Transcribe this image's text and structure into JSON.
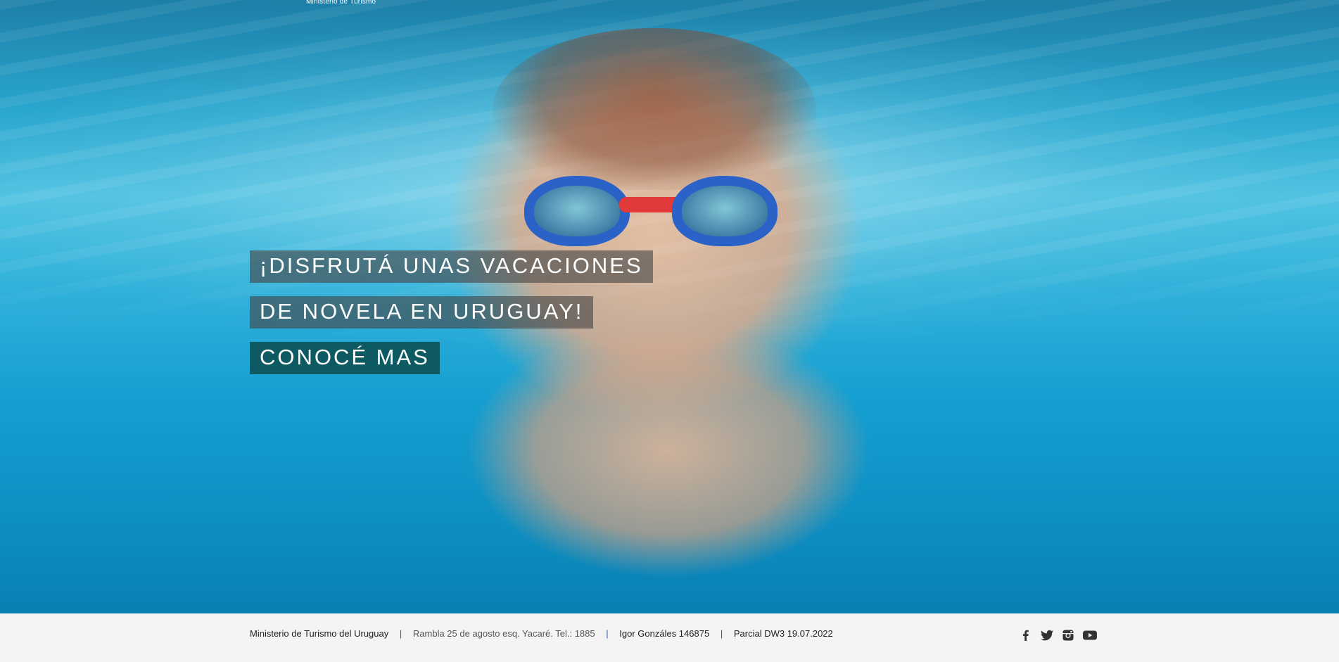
{
  "header": {
    "site_tag": "Ministerio de Turismo"
  },
  "hero": {
    "headline_line1": "¡DISFRUTÁ UNAS VACACIONES",
    "headline_line2": "DE NOVELA EN URUGUAY!",
    "cta_label": "CONOCÉ MAS",
    "colors": {
      "headline_bg": "#464646",
      "cta_bg": "#0e5a63",
      "water": "#159fd1"
    }
  },
  "footer": {
    "org": "Ministerio de Turismo del Uruguay",
    "address": "Rambla 25 de agosto esq. Yacaré. Tel.: 1885",
    "author": "Igor Gonzáles 146875",
    "exam": "Parcial DW3 19.07.2022",
    "separator": "|",
    "social": [
      {
        "name": "facebook",
        "icon": "facebook-icon"
      },
      {
        "name": "twitter",
        "icon": "twitter-icon"
      },
      {
        "name": "instagram",
        "icon": "instagram-icon"
      },
      {
        "name": "youtube",
        "icon": "youtube-icon"
      }
    ]
  }
}
